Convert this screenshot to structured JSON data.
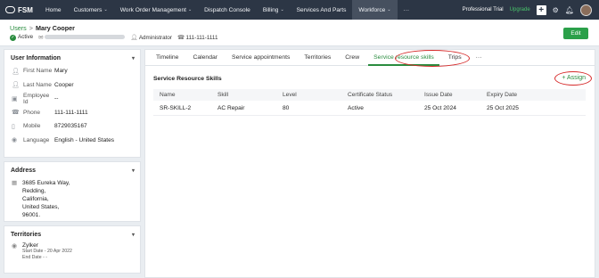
{
  "app": {
    "name": "FSM"
  },
  "nav": {
    "items": [
      {
        "label": "Home",
        "caret": false
      },
      {
        "label": "Customers",
        "caret": true
      },
      {
        "label": "Work Order Management",
        "caret": true
      },
      {
        "label": "Dispatch Console",
        "caret": false
      },
      {
        "label": "Billing",
        "caret": true
      },
      {
        "label": "Services And Parts",
        "caret": false
      },
      {
        "label": "Workforce",
        "caret": true,
        "active": true
      }
    ],
    "more_label": "···",
    "trial_label": "Professional Trial",
    "upgrade_label": "Upgrade"
  },
  "header": {
    "breadcrumb_link": "Users",
    "breadcrumb_sep": ">",
    "user_name": "Mary Cooper",
    "status": "Active",
    "role": "Administrator",
    "phone": "111-111-1111",
    "edit_label": "Edit"
  },
  "user_info": {
    "title": "User Information",
    "fields": [
      {
        "icon": "person-icon",
        "label": "First Name",
        "value": "Mary"
      },
      {
        "icon": "person-icon",
        "label": "Last Name",
        "value": "Cooper"
      },
      {
        "icon": "id-card-icon",
        "label": "Employee Id",
        "value": "--"
      },
      {
        "icon": "phone-icon",
        "label": "Phone",
        "value": "111-111-1111"
      },
      {
        "icon": "mobile-icon",
        "label": "Mobile",
        "value": "8729035167"
      },
      {
        "icon": "globe-icon",
        "label": "Language",
        "value": "English - United States"
      }
    ]
  },
  "address": {
    "title": "Address",
    "lines": [
      "3685 Eureka Way,",
      "Redding,",
      "California,",
      "United States,",
      "96001."
    ]
  },
  "territories": {
    "title": "Territories",
    "name": "Zylker",
    "start_date": "Start Date - 20 Apr 2022",
    "end_date": "End Date - -"
  },
  "tabs": [
    {
      "label": "Timeline"
    },
    {
      "label": "Calendar"
    },
    {
      "label": "Service appointments"
    },
    {
      "label": "Territories"
    },
    {
      "label": "Crew"
    },
    {
      "label": "Service resource skills",
      "active": true
    },
    {
      "label": "Trips"
    },
    {
      "label": "···"
    }
  ],
  "skills": {
    "title": "Service Resource Skills",
    "assign_label": "+ Assign",
    "columns": [
      "Name",
      "Skill",
      "Level",
      "Certificate Status",
      "Issue Date",
      "Expiry Date"
    ],
    "rows": [
      [
        "SR-SKILL-2",
        "AC Repair",
        "80",
        "Active",
        "25 Oct 2024",
        "25 Oct 2025"
      ]
    ]
  },
  "colors": {
    "accent": "#2a8c3f",
    "topbar": "#2c3645",
    "annotation": "#d62b2b"
  }
}
